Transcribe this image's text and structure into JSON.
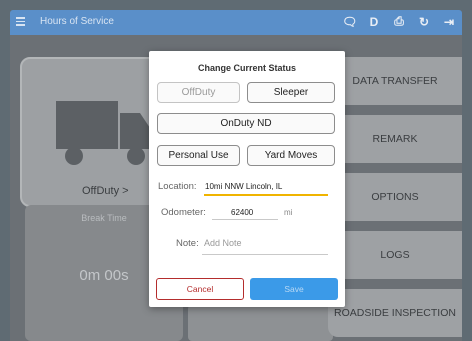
{
  "app_bar": {
    "title": "Hours of Service",
    "icons": [
      {
        "name": "chat-icon",
        "glyph": "🗨"
      },
      {
        "name": "d-icon",
        "glyph": "D"
      },
      {
        "name": "device-icon",
        "glyph": "⎙"
      },
      {
        "name": "refresh-icon",
        "glyph": "↻"
      },
      {
        "name": "logout-icon",
        "glyph": "⇥"
      }
    ],
    "color": "#5a8fc9"
  },
  "background": {
    "status_label": "OffDuty >",
    "break_label": "Break Time",
    "break_value": "0m 00s",
    "right_buttons": [
      "DATA TRANSFER",
      "REMARK",
      "OPTIONS",
      "LOGS",
      "ROADSIDE INSPECTION"
    ]
  },
  "dialog": {
    "title": "Change Current Status",
    "status_buttons": {
      "off_duty": "OffDuty",
      "sleeper": "Sleeper",
      "on_duty": "OnDuty ND",
      "personal_use": "Personal Use",
      "yard_moves": "Yard Moves"
    },
    "location": {
      "label": "Location:",
      "value": "10mi NNW Lincoln, IL"
    },
    "odometer": {
      "label": "Odometer:",
      "value": "62400",
      "unit": "mi"
    },
    "note": {
      "label": "Note:",
      "placeholder": "Add Note"
    },
    "cancel_label": "Cancel",
    "save_label": "Save"
  },
  "colors": {
    "accent": "#3b9ae8",
    "cancel": "#b42d2d",
    "active_underline": "#f0b400"
  }
}
